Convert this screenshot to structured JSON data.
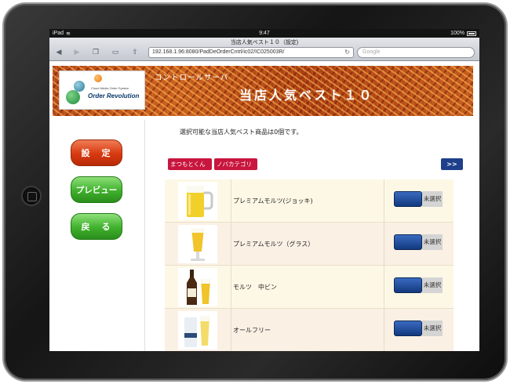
{
  "status_bar": {
    "device": "iPad",
    "time": "9:47",
    "battery": "100%"
  },
  "browser": {
    "page_title": "当店人気ベスト１０（設定)",
    "url": "192.168.1.96:8080/PadDeOrderCntrl/ic02/IC025003R/",
    "search_placeholder": "Google"
  },
  "banner": {
    "logo_tagline": "Cloud Media Order System",
    "logo_name": "Order Revolution",
    "subtitle": "コントロールサーバ",
    "title": "当店人気ベスト１０"
  },
  "sidebar": {
    "settings_label": "設　定",
    "preview_label": "プレビュー",
    "back_label": "戻　る"
  },
  "main": {
    "message": "選択可能な当店人気ベスト商品は0個です。",
    "category_tabs": [
      "まつもとくん",
      "ノバカテゴリ"
    ],
    "next_label": ">>"
  },
  "products": [
    {
      "name": "プレミアムモルツ(ジョッキ)",
      "status": "未選択",
      "icon": "beer-mug-icon"
    },
    {
      "name": "プレミアムモルツ（グラス）",
      "status": "未選択",
      "icon": "beer-glass-icon"
    },
    {
      "name": "モルツ　中ビン",
      "status": "未選択",
      "icon": "beer-bottle-icon"
    },
    {
      "name": "オールフリー",
      "status": "未選択",
      "icon": "can-and-glass-icon"
    }
  ],
  "colors": {
    "accent_red": "#c8163e",
    "button_blue": "#1e3f8a",
    "settings_red": "#d73910",
    "nav_green": "#3fb02c"
  }
}
